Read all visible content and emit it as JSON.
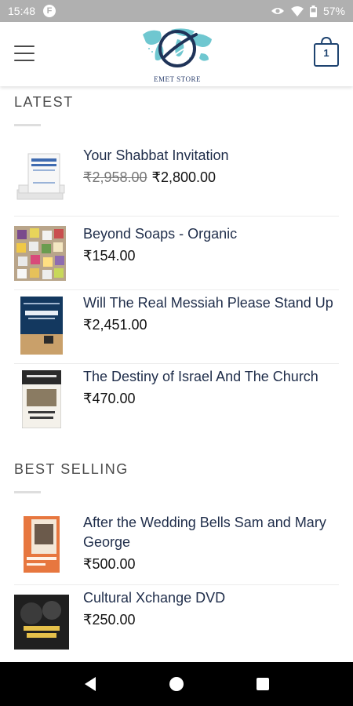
{
  "status_bar": {
    "time": "15:48",
    "app_icon_letter": "F",
    "battery": "57%"
  },
  "header": {
    "logo_text": "EMET STORE",
    "cart_count": "1"
  },
  "sections": [
    {
      "title": "LATEST",
      "products": [
        {
          "name": "Your Shabbat Invitation",
          "price_old": "₹2,958.00",
          "price": "₹2,800.00",
          "thumb": "book-stack"
        },
        {
          "name": "Beyond Soaps - Organic",
          "price_old": "",
          "price": "₹154.00",
          "thumb": "soaps"
        },
        {
          "name": "Will The Real Messiah Please Stand Up",
          "price_old": "",
          "price": "₹2,451.00",
          "thumb": "messiah-book"
        },
        {
          "name": "The Destiny of Israel And The Church",
          "price_old": "",
          "price": "₹470.00",
          "thumb": "destiny-book"
        }
      ]
    },
    {
      "title": "BEST SELLING",
      "products": [
        {
          "name": "After the Wedding Bells Sam and Mary George",
          "price_old": "",
          "price": "₹500.00",
          "thumb": "wedding-book"
        },
        {
          "name": "Cultural Xchange DVD",
          "price_old": "",
          "price": "₹250.00",
          "thumb": "cultural-dvd"
        }
      ]
    }
  ],
  "colors": {
    "title_navy": "#1f2d4a",
    "status_gray": "#b0b0b0",
    "cart_blue": "#1e4370"
  }
}
